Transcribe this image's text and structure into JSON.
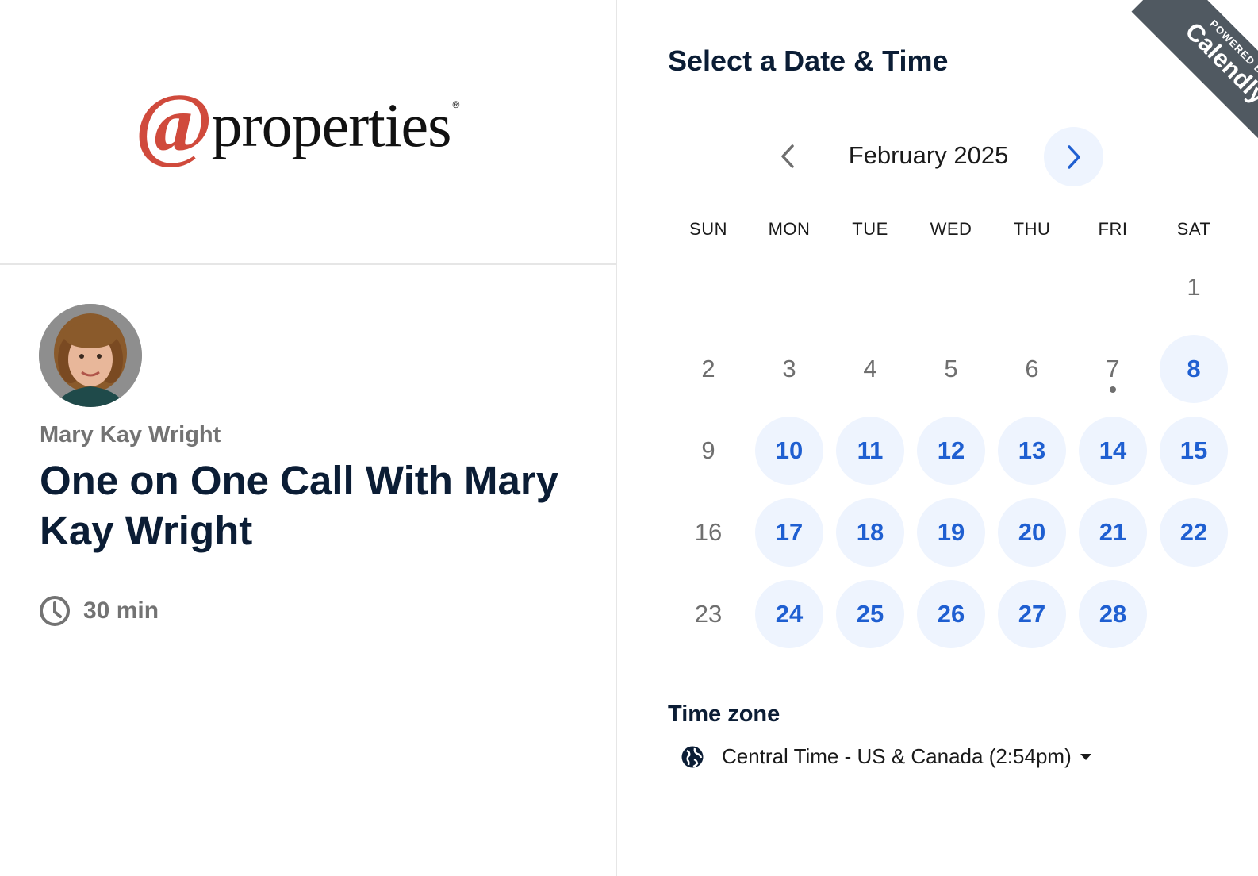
{
  "brand": {
    "logo_symbol": "@",
    "logo_word": "properties",
    "logo_reg": "®",
    "logo_color": "#d04a3c"
  },
  "host": {
    "name": "Mary Kay Wright",
    "avatar_icon": "profile-photo"
  },
  "event": {
    "title": "One on One Call With Mary Kay Wright",
    "duration": "30 min",
    "duration_icon": "clock-icon"
  },
  "calendar": {
    "heading": "Select a Date & Time",
    "month_label": "February 2025",
    "prev_icon": "chevron-left-icon",
    "next_icon": "chevron-right-icon",
    "weekdays": [
      "SUN",
      "MON",
      "TUE",
      "WED",
      "THU",
      "FRI",
      "SAT"
    ],
    "days": [
      {
        "label": "1",
        "available": false
      },
      {
        "label": "2",
        "available": false
      },
      {
        "label": "3",
        "available": false
      },
      {
        "label": "4",
        "available": false
      },
      {
        "label": "5",
        "available": false
      },
      {
        "label": "6",
        "available": false
      },
      {
        "label": "7",
        "available": false,
        "today": true
      },
      {
        "label": "8",
        "available": true
      },
      {
        "label": "9",
        "available": false
      },
      {
        "label": "10",
        "available": true
      },
      {
        "label": "11",
        "available": true
      },
      {
        "label": "12",
        "available": true
      },
      {
        "label": "13",
        "available": true
      },
      {
        "label": "14",
        "available": true
      },
      {
        "label": "15",
        "available": true
      },
      {
        "label": "16",
        "available": false
      },
      {
        "label": "17",
        "available": true
      },
      {
        "label": "18",
        "available": true
      },
      {
        "label": "19",
        "available": true
      },
      {
        "label": "20",
        "available": true
      },
      {
        "label": "21",
        "available": true
      },
      {
        "label": "22",
        "available": true
      },
      {
        "label": "23",
        "available": false
      },
      {
        "label": "24",
        "available": true
      },
      {
        "label": "25",
        "available": true
      },
      {
        "label": "26",
        "available": true
      },
      {
        "label": "27",
        "available": true
      },
      {
        "label": "28",
        "available": true
      }
    ],
    "first_weekday_index": 6,
    "accent_color": "#1f5fd1",
    "available_bg": "#eef4fe"
  },
  "timezone": {
    "heading": "Time zone",
    "value": "Central Time - US & Canada (2:54pm)",
    "icon": "globe-icon"
  },
  "ribbon": {
    "small": "POWERED BY",
    "brand": "Calendly"
  }
}
